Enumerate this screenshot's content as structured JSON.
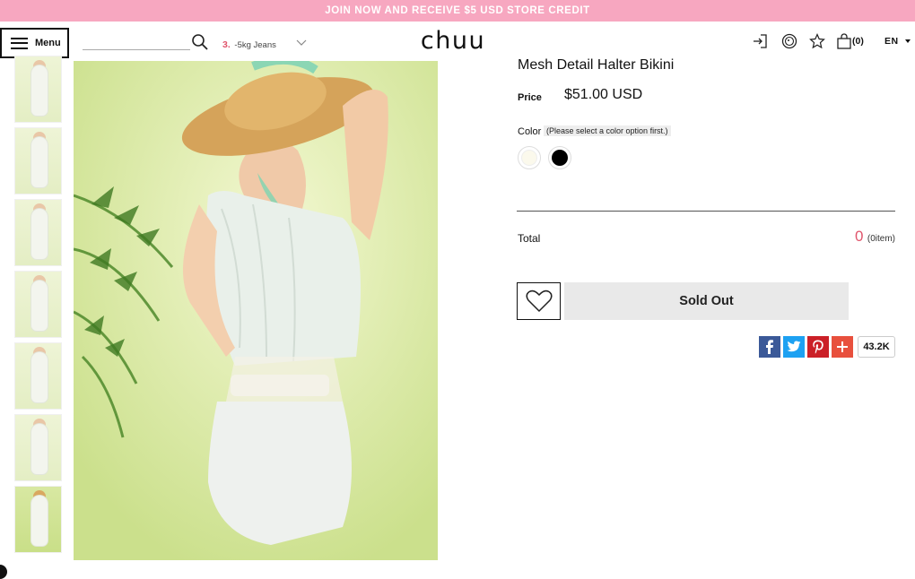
{
  "promo_banner": "JOIN NOW AND RECEIVE $5 USD STORE CREDIT",
  "header": {
    "menu_label": "Menu",
    "search_placeholder": "",
    "trending_rank": "3.",
    "trending_term": "-5kg Jeans",
    "logo": "chuu",
    "cart_count": "(0)",
    "language": "EN"
  },
  "product": {
    "title": "Mesh Detail Halter Bikini",
    "price_label": "Price",
    "price_value": "$51.00 USD",
    "color_label": "Color",
    "color_note": "(Please select a color option first.)",
    "colors": [
      {
        "name": "ivory",
        "hex": "#fbf9ec"
      },
      {
        "name": "black",
        "hex": "#000000"
      }
    ],
    "total_label": "Total",
    "total_value": "0",
    "total_items": "(0item)",
    "sold_out_label": "Sold Out",
    "share_count": "43.2K"
  },
  "share_buttons": [
    {
      "name": "facebook",
      "glyph": "f",
      "color": "#3b5998"
    },
    {
      "name": "twitter",
      "glyph": "t",
      "color": "#1da1f2"
    },
    {
      "name": "pinterest",
      "glyph": "p",
      "color": "#cb2027"
    },
    {
      "name": "more",
      "glyph": "+",
      "color": "#e8503d"
    }
  ],
  "colors": {
    "promo_bg": "#f7a7c0",
    "accent_pink": "#e0556c",
    "soldout_bg": "#e9e9e9"
  }
}
